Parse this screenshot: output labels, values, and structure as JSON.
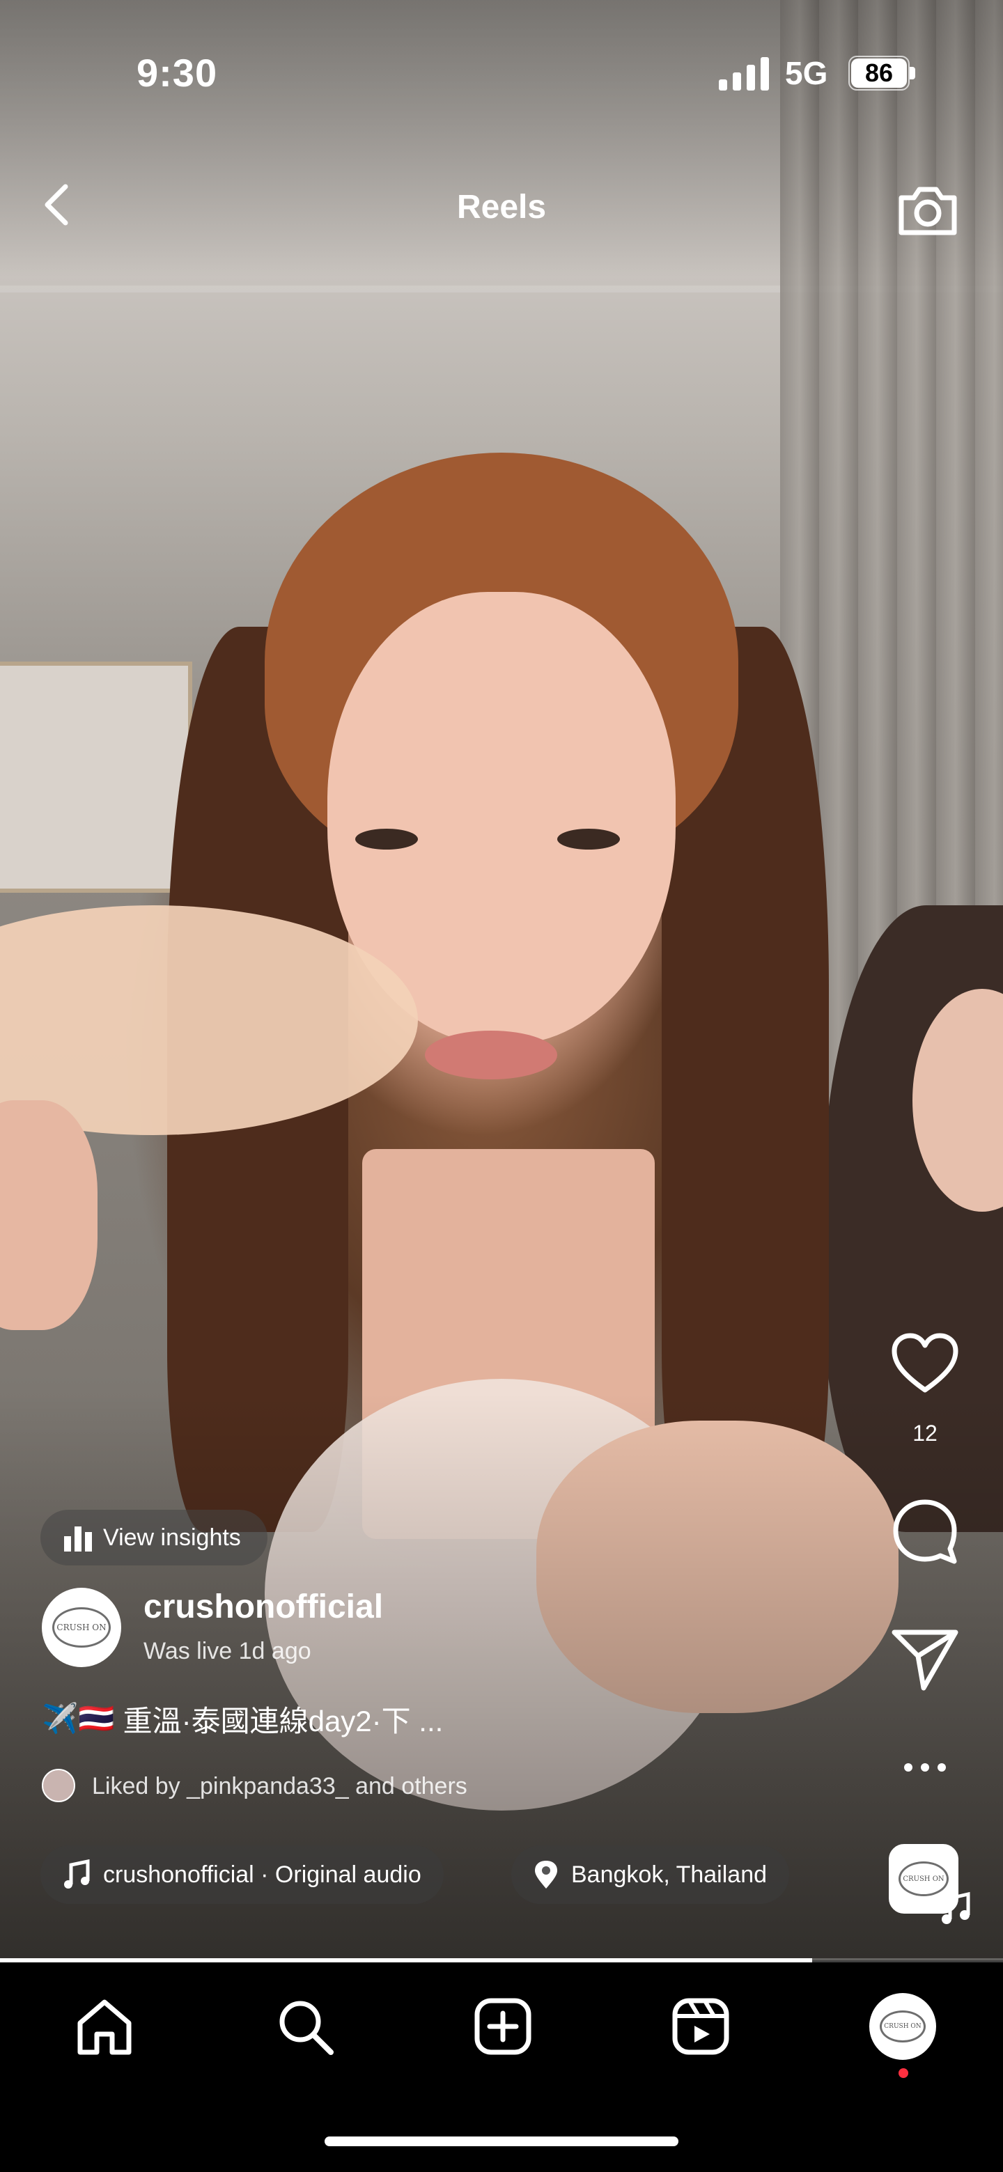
{
  "status_bar": {
    "time": "9:30",
    "network": "5G",
    "battery": "86",
    "signal_icon": "signal-bars-icon",
    "battery_icon": "battery-icon"
  },
  "header": {
    "title": "Reels",
    "back_icon": "chevron-left-icon",
    "camera_icon": "camera-icon"
  },
  "actions": {
    "like_count": "12",
    "like_icon": "heart-icon",
    "comment_icon": "comment-icon",
    "share_icon": "send-icon",
    "more_icon": "more-horizontal-icon"
  },
  "post": {
    "insights_label": "View insights",
    "username": "crushonofficial",
    "live_status": "Was live 1d ago",
    "avatar_text": "CRUSH ON",
    "caption_emojis": "✈️🇹🇭",
    "caption": "重溫·泰國連線day2·下 ...",
    "liked_by_prefix": "Liked by ",
    "liked_by_user": "_pinkpanda33_",
    "liked_by_and": " and ",
    "liked_by_others": "others",
    "audio": "crushonofficial · Original audio",
    "location": "Bangkok, Thailand"
  },
  "playback": {
    "progress": 0.81
  },
  "tab_bar": {
    "items": [
      "home-icon",
      "search-icon",
      "create-icon",
      "reels-icon",
      "profile-avatar"
    ]
  },
  "colors": {
    "notification_dot": "#ff3040",
    "overlay_chip": "rgba(60,60,60,0.55)"
  }
}
